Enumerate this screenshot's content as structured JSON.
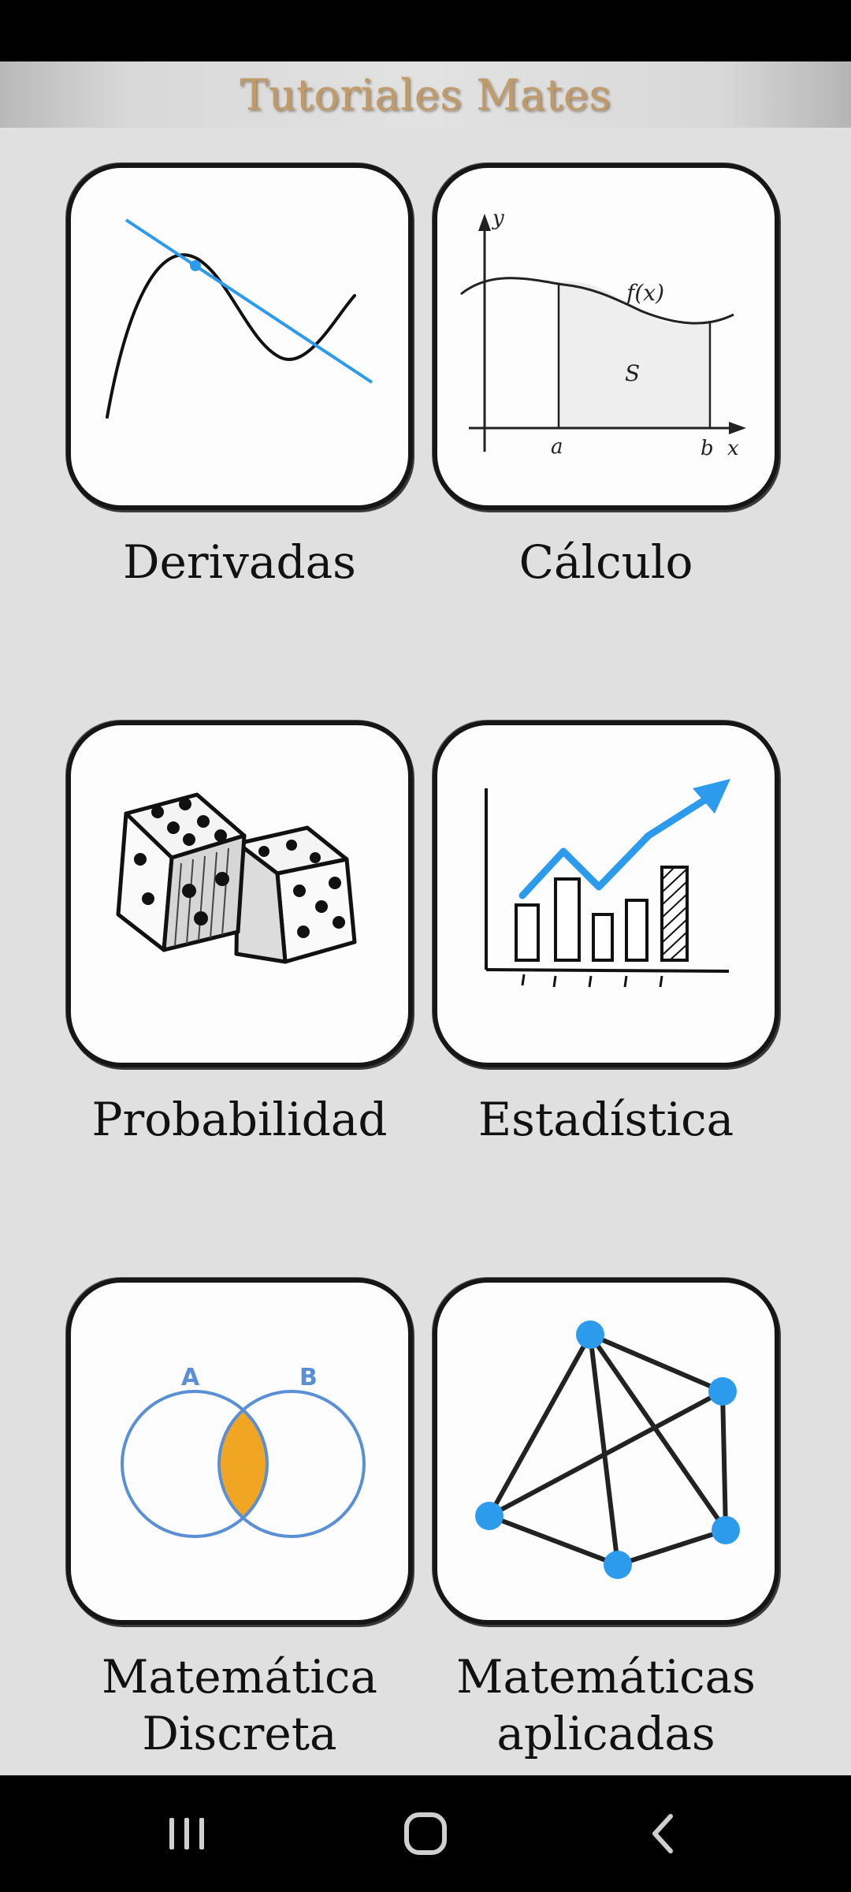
{
  "app": {
    "title": "Tutoriales Mates"
  },
  "tiles": [
    {
      "label": "Derivadas",
      "icon": "tangent-line-icon"
    },
    {
      "label": "Cálculo",
      "icon": "integral-area-icon",
      "labels": {
        "y": "y",
        "fx": "f(x)",
        "s": "S",
        "a": "a",
        "b": "b",
        "x": "x"
      }
    },
    {
      "label": "Probabilidad",
      "icon": "dice-icon"
    },
    {
      "label": "Estadística",
      "icon": "bar-chart-trend-icon"
    },
    {
      "label_line1": "Matemática",
      "label_line2": "Discreta",
      "icon": "venn-diagram-icon",
      "labels": {
        "a": "A",
        "b": "B"
      }
    },
    {
      "label_line1": "Matemáticas",
      "label_line2": "aplicadas",
      "icon": "graph-network-icon"
    }
  ],
  "colors": {
    "accent_blue": "#2d9bec",
    "venn_blue": "#5a8fd6",
    "venn_orange": "#f0a623",
    "title_gold": "#c09a68"
  }
}
